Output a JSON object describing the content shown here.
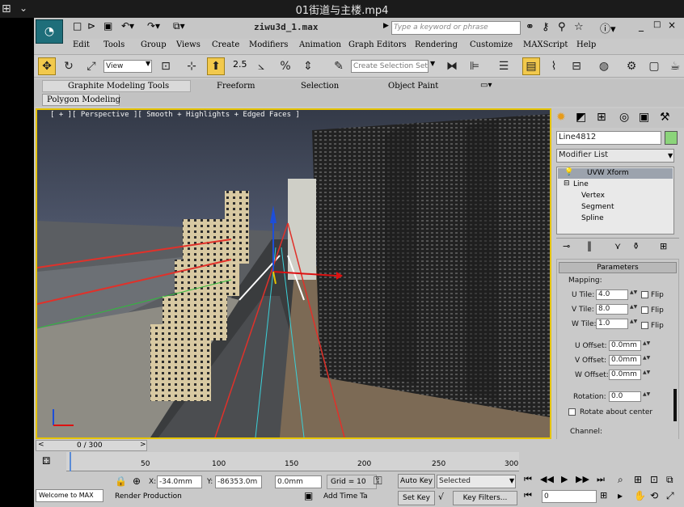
{
  "video": {
    "title": "01街道与主楼.mp4"
  },
  "window": {
    "title": "ziwu3d_1.max",
    "search_placeholder": "Type a keyword or phrase"
  },
  "menu": [
    "Edit",
    "Tools",
    "Group",
    "Views",
    "Create",
    "Modifiers",
    "Animation",
    "Graph Editors",
    "Rendering",
    "Customize",
    "MAXScript",
    "Help"
  ],
  "toolbar": {
    "view_select": "View",
    "selection_set_placeholder": "Create Selection Set",
    "angle_snap": "2.5"
  },
  "ribbon": {
    "tabs": [
      "Graphite Modeling Tools",
      "Freeform",
      "Selection",
      "Object Paint"
    ],
    "sub": "Polygon Modeling"
  },
  "viewport": {
    "label": "[ + ][ Perspective ][ Smooth + Highlights + Edged Faces ]"
  },
  "command_panel": {
    "object_name": "Line4812",
    "modifier_list": "Modifier List",
    "stack": [
      {
        "label": "UVW Xform"
      },
      {
        "label": "Line"
      },
      {
        "label": "Vertex"
      },
      {
        "label": "Segment"
      },
      {
        "label": "Spline"
      }
    ],
    "rollout": "Parameters",
    "group_mapping": "Mapping:",
    "u_tile_label": "U Tile:",
    "u_tile": "4.0",
    "v_tile_label": "V Tile:",
    "v_tile": "8.0",
    "w_tile_label": "W Tile:",
    "w_tile": "1.0",
    "flip": "Flip",
    "u_offset_label": "U Offset:",
    "u_offset": "0.0mm",
    "v_offset_label": "V Offset:",
    "v_offset": "0.0mm",
    "w_offset_label": "W Offset:",
    "w_offset": "0.0mm",
    "rotation_label": "Rotation:",
    "rotation": "0.0",
    "rotate_center": "Rotate about center",
    "channel": "Channel:"
  },
  "timeline": {
    "frame": "0 / 300",
    "ticks": [
      "50",
      "100",
      "150",
      "200",
      "250",
      "300"
    ]
  },
  "status": {
    "x_label": "X:",
    "x": "-34.0mm",
    "y_label": "Y:",
    "y": "-86353.0m",
    "z": "0.0mm",
    "grid": "Grid = 10",
    "auto_key": "Auto Key",
    "key_mode": "Selected",
    "set_key": "Set Key",
    "key_filters": "Key Filters...",
    "frame_field": "0",
    "welcome": "Welcome to MAX",
    "render_production": "Render Production",
    "add_time_tag": "Add Time Ta"
  }
}
